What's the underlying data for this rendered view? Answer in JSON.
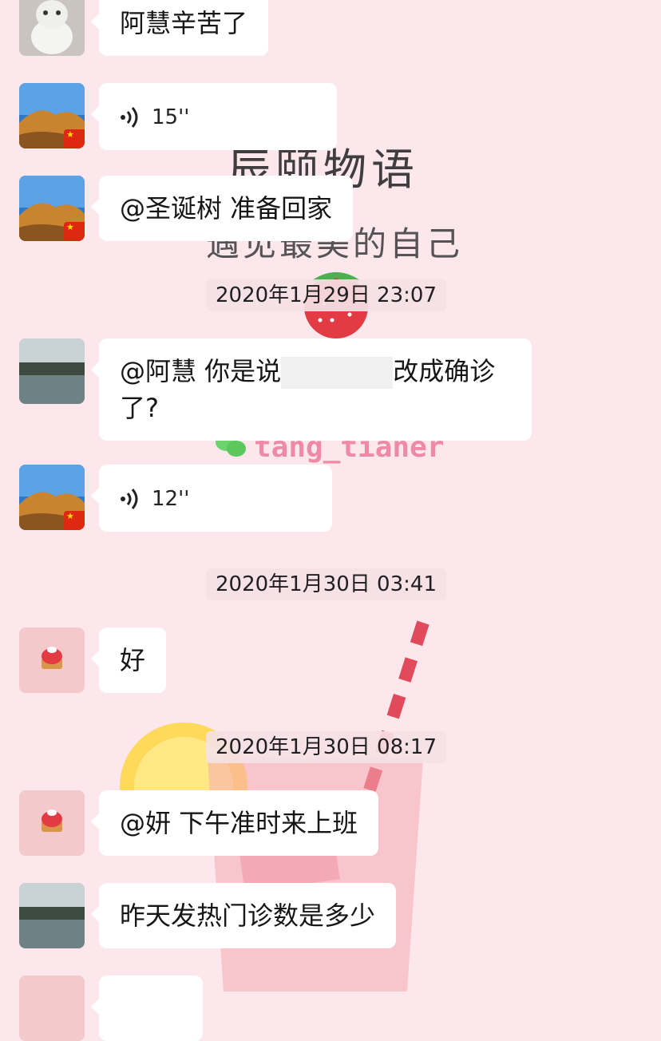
{
  "wallpaper": {
    "title": "辰颐物语",
    "subtitle": "遇见最美的自己",
    "watermark": "tang_tianer"
  },
  "messages": [
    {
      "avatar": "cat",
      "text": "阿慧辛苦了"
    },
    {
      "avatar": "desert",
      "voice_length": "15''"
    },
    {
      "avatar": "desert",
      "text": "@圣诞树 准备回家"
    },
    {
      "timestamp": "2020年1月29日 23:07"
    },
    {
      "avatar": "river",
      "text_before": "@阿慧 你是说",
      "text_after": "改成确诊了?"
    },
    {
      "avatar": "desert",
      "voice_length": "12''"
    },
    {
      "timestamp": "2020年1月30日 03:41"
    },
    {
      "avatar": "strawberry-cake",
      "text": "好"
    },
    {
      "timestamp": "2020年1月30日 08:17"
    },
    {
      "avatar": "strawberry-cake",
      "text": "@妍 下午准时来上班"
    },
    {
      "avatar": "river",
      "text": "昨天发热门诊数是多少"
    },
    {
      "avatar": "strawberry-cake",
      "text": ""
    }
  ],
  "colors": {
    "background": "#fbe7ec",
    "bubble": "#ffffff",
    "timestamp_bg": "#f5e1e6"
  }
}
